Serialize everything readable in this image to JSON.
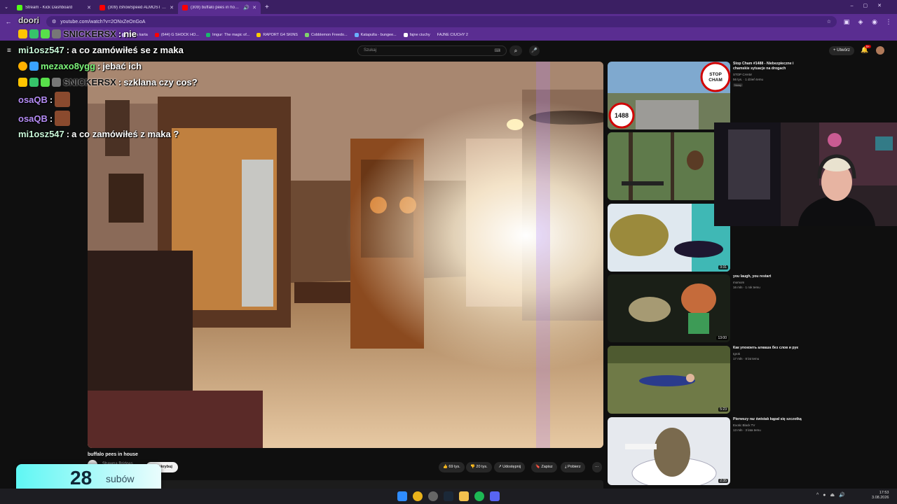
{
  "browser": {
    "tabs": [
      {
        "label": "Stream - Kick Dashboard",
        "active": false,
        "favicon_color": "#53fc18"
      },
      {
        "label": "(309) iShowSpeed ALMOST DI...",
        "active": false,
        "favicon_color": "#ff0000"
      },
      {
        "label": "(309) buffalo pees in house",
        "active": true,
        "favicon_color": "#ff0000"
      }
    ],
    "url": "youtube.com/watch?v=2ONxZeOnGoA",
    "bookmarks": [
      "Nowa karta",
      "(644) G SHOCK HO...",
      "Imgur: The magic of...",
      "RAPORT G4 SKINS",
      "Cobblemon Freedo...",
      "Katapulta - bungee...",
      "fajne ciuchy",
      "FAJNE CIUCHY 2"
    ]
  },
  "youtube": {
    "search_placeholder": "Szukaj",
    "create_label": "Utwórz",
    "notif_count": "9+",
    "video": {
      "title": "buffalo pees in house",
      "channel": "Shawna Bridges",
      "subscribe_label": "Subskrybuj",
      "likes": "69 tys.",
      "dislikes": "20 tys.",
      "share_label": "Udostępnij",
      "save_label": "Zapisz",
      "download_label": "Pobierz"
    },
    "recommendations": [
      {
        "title": "Stop Cham #1488 - Niebezpieczne i chamskie sytuacje na drogach",
        "channel": "STOP CHAM",
        "stats": "56 tys. · 1 dzień temu",
        "badge": "Nowy",
        "duration": "",
        "thumb_text_1": "1488",
        "thumb_text_2": "STOP CHAM"
      },
      {
        "title": "",
        "channel": "",
        "stats": "",
        "badge": "",
        "duration": ""
      },
      {
        "title": "",
        "channel": "",
        "stats": "",
        "badge": "",
        "duration": "3:31"
      },
      {
        "title": "you laugh, you restart",
        "channel": "momom",
        "stats": "16 mln · 1 rok temu",
        "badge": "",
        "duration": "13:00"
      },
      {
        "title": "Как упокоить алкаша без слов и рук",
        "channel": "Igrok",
        "stats": "17 mln · 8 lat temu",
        "badge": "",
        "duration": "5:23"
      },
      {
        "title": "Pierwszy raz świstak kąpał się szczotką",
        "channel": "Exotic Black TV",
        "stats": "13 mln · 3 lata temu",
        "badge": "",
        "duration": "2:35"
      }
    ]
  },
  "chat": {
    "header": "doori",
    "messages": [
      {
        "user": "SNICKERSX",
        "text": "nie",
        "user_color": "#ffffff"
      },
      {
        "user": "mi1osz547",
        "text": "a co zamówiłeś se z maka",
        "user_color": "#c9f7d8"
      },
      {
        "user": "mezaxo8ygg",
        "text": "jebać ich",
        "user_color": "#7cf57a"
      },
      {
        "user": "SNICKERSX",
        "text": "szklana czy cos?",
        "user_color": "#ffffff"
      },
      {
        "user": "osaQB",
        "text": "",
        "user_color": "#b58cf5"
      },
      {
        "user": "osaQB",
        "text": "",
        "user_color": "#b58cf5"
      },
      {
        "user": "mi1osz547",
        "text": "a co zamówiłeś z maka ?",
        "user_color": "#c9f7d8"
      }
    ]
  },
  "sub_counter": {
    "count": "28",
    "label": "subów"
  },
  "taskbar": {
    "time": "17:53",
    "date": "3.08.2026"
  }
}
